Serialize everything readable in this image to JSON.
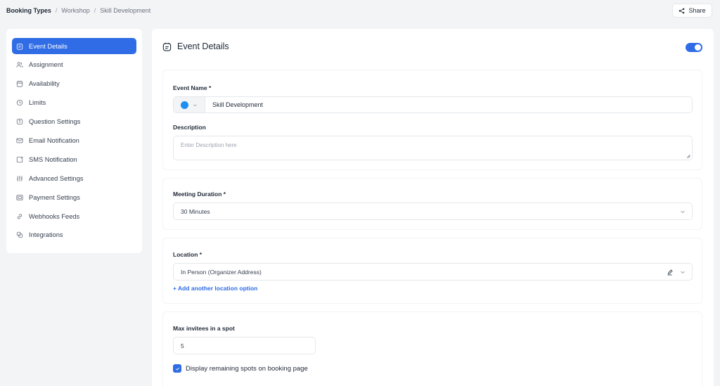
{
  "breadcrumb": {
    "root": "Booking Types",
    "items": [
      "Workshop",
      "Skill Development"
    ],
    "separator": "/"
  },
  "share": {
    "label": "Share",
    "icon": "share-icon"
  },
  "sidebar": {
    "active_color": "#2f6ce5",
    "items": [
      {
        "label": "Event Details",
        "icon": "calendar-note-icon",
        "active": true
      },
      {
        "label": "Assignment",
        "icon": "users-icon",
        "active": false
      },
      {
        "label": "Availability",
        "icon": "calendar-icon",
        "active": false
      },
      {
        "label": "Limits",
        "icon": "clock-icon",
        "active": false
      },
      {
        "label": "Question Settings",
        "icon": "question-icon",
        "active": false
      },
      {
        "label": "Email Notification",
        "icon": "mail-icon",
        "active": false
      },
      {
        "label": "SMS Notification",
        "icon": "sms-icon",
        "active": false
      },
      {
        "label": "Advanced Settings",
        "icon": "sliders-icon",
        "active": false
      },
      {
        "label": "Payment Settings",
        "icon": "payment-icon",
        "active": false
      },
      {
        "label": "Webhooks Feeds",
        "icon": "link-icon",
        "active": false
      },
      {
        "label": "Integrations",
        "icon": "integrations-icon",
        "active": false
      }
    ]
  },
  "main": {
    "title": "Event Details",
    "enabled": true,
    "event_name": {
      "label": "Event Name *",
      "color": "#1e8ff0",
      "value": "Skill Development"
    },
    "description": {
      "label": "Description",
      "placeholder": "Enter Description here",
      "value": ""
    },
    "meeting_duration": {
      "label": "Meeting Duration *",
      "value": "30 Minutes"
    },
    "location": {
      "label": "Location *",
      "value": "In Person (Organizer Address)",
      "add_link": "+ Add another location option"
    },
    "max_invitees": {
      "label": "Max invitees in a spot",
      "value": "5"
    },
    "display_remaining": {
      "label": "Display remaining spots on booking page",
      "checked": true
    }
  }
}
